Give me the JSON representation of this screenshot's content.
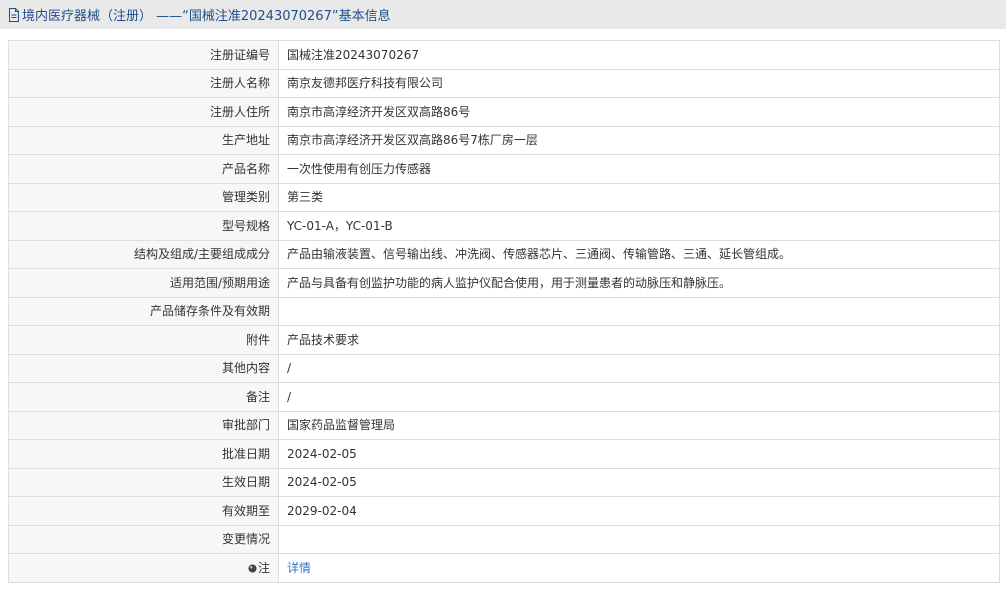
{
  "header": {
    "title": "境内医疗器械（注册） ——“国械注准20243070267”基本信息",
    "icon": "document-icon"
  },
  "rows": [
    {
      "label": "注册证编号",
      "value": "国械注准20243070267"
    },
    {
      "label": "注册人名称",
      "value": "南京友德邦医疗科技有限公司"
    },
    {
      "label": "注册人住所",
      "value": "南京市高淳经济开发区双高路86号"
    },
    {
      "label": "生产地址",
      "value": "南京市高淳经济开发区双高路86号7栋厂房一层"
    },
    {
      "label": "产品名称",
      "value": "一次性使用有创压力传感器"
    },
    {
      "label": "管理类别",
      "value": "第三类"
    },
    {
      "label": "型号规格",
      "value": "YC-01-A，YC-01-B"
    },
    {
      "label": "结构及组成/主要组成成分",
      "value": "产品由输液装置、信号输出线、冲洗阀、传感器芯片、三通阀、传输管路、三通、延长管组成。"
    },
    {
      "label": "适用范围/预期用途",
      "value": "产品与具备有创监护功能的病人监护仪配合使用，用于测量患者的动脉压和静脉压。"
    },
    {
      "label": "产品储存条件及有效期",
      "value": ""
    },
    {
      "label": "附件",
      "value": "产品技术要求"
    },
    {
      "label": "其他内容",
      "value": "/"
    },
    {
      "label": "备注",
      "value": "/"
    },
    {
      "label": "审批部门",
      "value": "国家药品监督管理局"
    },
    {
      "label": "批准日期",
      "value": "2024-02-05"
    },
    {
      "label": "生效日期",
      "value": "2024-02-05"
    },
    {
      "label": "有效期至",
      "value": "2029-02-04"
    },
    {
      "label": "变更情况",
      "value": ""
    }
  ],
  "note_row": {
    "label": "注",
    "link": "详情",
    "icon": "info-dot-icon"
  },
  "colors": {
    "header_bg": "#e9e9e9",
    "header_text": "#1f4f8a",
    "link": "#3a78c3",
    "label_bg": "#f7f7f7",
    "border": "#dddddd"
  }
}
